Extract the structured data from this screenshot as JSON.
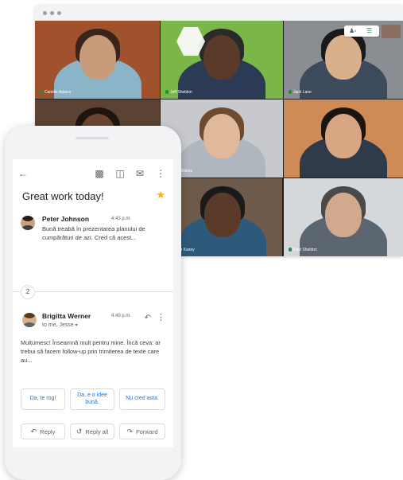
{
  "meet": {
    "participants": [
      {
        "name": "Camille Adams",
        "bg": "#a0522d",
        "skin": "#c89b7b",
        "hair": "#3b2418",
        "shirt": "#8ab4c8",
        "muted": false
      },
      {
        "name": "Jeff Sheldon",
        "bg": "#7ab648",
        "skin": "#5a3a28",
        "hair": "#2a2a2a",
        "shirt": "#2b3a55",
        "muted": false
      },
      {
        "name": "Jack Lane",
        "bg": "#8a8d91",
        "skin": "#d9b08c",
        "hair": "#1a1a1a",
        "shirt": "#3c4a5c",
        "muted": false
      },
      {
        "name": "",
        "bg": "#5b4232",
        "skin": "#6b4530",
        "hair": "#1f140e",
        "shirt": "#3a2c22",
        "muted": false
      },
      {
        "name": "Jen Williams",
        "bg": "#c7c9cc",
        "skin": "#e0b89a",
        "hair": "#6e4a2e",
        "shirt": "#b0b6bd",
        "muted": false
      },
      {
        "name": "",
        "bg": "#cf8b55",
        "skin": "#d9a683",
        "hair": "#1c1410",
        "shirt": "#2f3a4a",
        "muted": true
      },
      {
        "name": "Oscar Kasey",
        "bg": "#6d5a4a",
        "skin": "#5a3a28",
        "hair": "#1a1a1a",
        "shirt": "#2d5a7a",
        "muted": false
      },
      {
        "name": "Ravi Sheldon",
        "bg": "#d5d8db",
        "skin": "#d2a98c",
        "hair": "#4a4a4a",
        "shirt": "#5b6670",
        "muted": false
      }
    ],
    "participant_count": "8"
  },
  "email": {
    "subject": "Great work today!",
    "collapsed_count": "2",
    "messages": [
      {
        "sender": "Peter Johnson",
        "time": "4:43 p.m.",
        "snippet": "Bună treabă în prezentarea planului de cumpărături de azi. Cred că acest..."
      },
      {
        "sender": "Brigitta Werner",
        "time": "4:49 p.m.",
        "recipient": "to me, Jesse",
        "body": "Mulțumesc! Înseamnă mult pentru mine. Încă ceva: ar trebui să facem follow-up prin trimiterea de texte care au..."
      }
    ],
    "smart_replies": [
      "Da, te rog!",
      "Da, e o idee bună.",
      "Nu cred asta."
    ],
    "actions": {
      "reply": "Reply",
      "reply_all": "Reply all",
      "forward": "Forward"
    }
  },
  "colors": {
    "accent": "#1a73e8",
    "star": "#f4b400"
  }
}
